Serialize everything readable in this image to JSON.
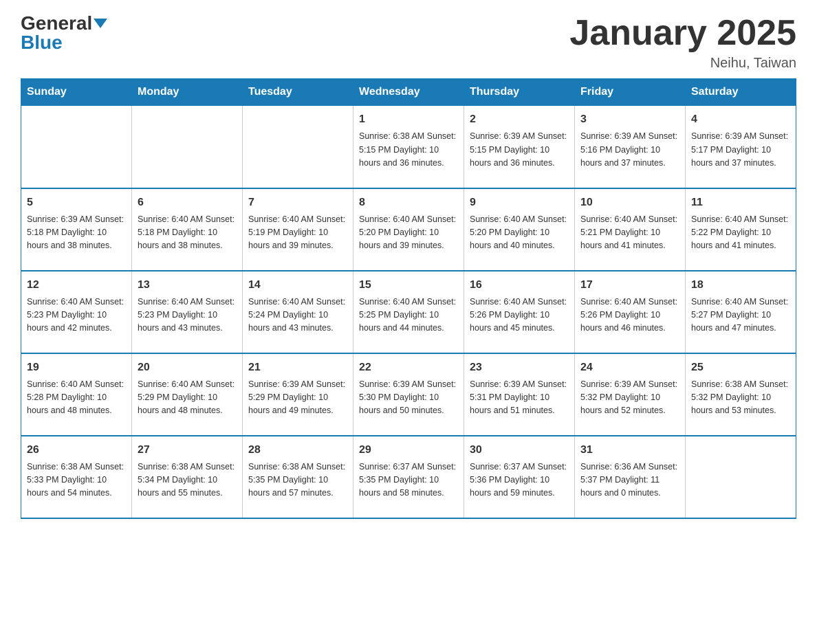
{
  "header": {
    "logo_general": "General",
    "logo_blue": "Blue",
    "title": "January 2025",
    "subtitle": "Neihu, Taiwan"
  },
  "weekdays": [
    "Sunday",
    "Monday",
    "Tuesday",
    "Wednesday",
    "Thursday",
    "Friday",
    "Saturday"
  ],
  "weeks": [
    [
      {
        "day": "",
        "info": ""
      },
      {
        "day": "",
        "info": ""
      },
      {
        "day": "",
        "info": ""
      },
      {
        "day": "1",
        "info": "Sunrise: 6:38 AM\nSunset: 5:15 PM\nDaylight: 10 hours\nand 36 minutes."
      },
      {
        "day": "2",
        "info": "Sunrise: 6:39 AM\nSunset: 5:15 PM\nDaylight: 10 hours\nand 36 minutes."
      },
      {
        "day": "3",
        "info": "Sunrise: 6:39 AM\nSunset: 5:16 PM\nDaylight: 10 hours\nand 37 minutes."
      },
      {
        "day": "4",
        "info": "Sunrise: 6:39 AM\nSunset: 5:17 PM\nDaylight: 10 hours\nand 37 minutes."
      }
    ],
    [
      {
        "day": "5",
        "info": "Sunrise: 6:39 AM\nSunset: 5:18 PM\nDaylight: 10 hours\nand 38 minutes."
      },
      {
        "day": "6",
        "info": "Sunrise: 6:40 AM\nSunset: 5:18 PM\nDaylight: 10 hours\nand 38 minutes."
      },
      {
        "day": "7",
        "info": "Sunrise: 6:40 AM\nSunset: 5:19 PM\nDaylight: 10 hours\nand 39 minutes."
      },
      {
        "day": "8",
        "info": "Sunrise: 6:40 AM\nSunset: 5:20 PM\nDaylight: 10 hours\nand 39 minutes."
      },
      {
        "day": "9",
        "info": "Sunrise: 6:40 AM\nSunset: 5:20 PM\nDaylight: 10 hours\nand 40 minutes."
      },
      {
        "day": "10",
        "info": "Sunrise: 6:40 AM\nSunset: 5:21 PM\nDaylight: 10 hours\nand 41 minutes."
      },
      {
        "day": "11",
        "info": "Sunrise: 6:40 AM\nSunset: 5:22 PM\nDaylight: 10 hours\nand 41 minutes."
      }
    ],
    [
      {
        "day": "12",
        "info": "Sunrise: 6:40 AM\nSunset: 5:23 PM\nDaylight: 10 hours\nand 42 minutes."
      },
      {
        "day": "13",
        "info": "Sunrise: 6:40 AM\nSunset: 5:23 PM\nDaylight: 10 hours\nand 43 minutes."
      },
      {
        "day": "14",
        "info": "Sunrise: 6:40 AM\nSunset: 5:24 PM\nDaylight: 10 hours\nand 43 minutes."
      },
      {
        "day": "15",
        "info": "Sunrise: 6:40 AM\nSunset: 5:25 PM\nDaylight: 10 hours\nand 44 minutes."
      },
      {
        "day": "16",
        "info": "Sunrise: 6:40 AM\nSunset: 5:26 PM\nDaylight: 10 hours\nand 45 minutes."
      },
      {
        "day": "17",
        "info": "Sunrise: 6:40 AM\nSunset: 5:26 PM\nDaylight: 10 hours\nand 46 minutes."
      },
      {
        "day": "18",
        "info": "Sunrise: 6:40 AM\nSunset: 5:27 PM\nDaylight: 10 hours\nand 47 minutes."
      }
    ],
    [
      {
        "day": "19",
        "info": "Sunrise: 6:40 AM\nSunset: 5:28 PM\nDaylight: 10 hours\nand 48 minutes."
      },
      {
        "day": "20",
        "info": "Sunrise: 6:40 AM\nSunset: 5:29 PM\nDaylight: 10 hours\nand 48 minutes."
      },
      {
        "day": "21",
        "info": "Sunrise: 6:39 AM\nSunset: 5:29 PM\nDaylight: 10 hours\nand 49 minutes."
      },
      {
        "day": "22",
        "info": "Sunrise: 6:39 AM\nSunset: 5:30 PM\nDaylight: 10 hours\nand 50 minutes."
      },
      {
        "day": "23",
        "info": "Sunrise: 6:39 AM\nSunset: 5:31 PM\nDaylight: 10 hours\nand 51 minutes."
      },
      {
        "day": "24",
        "info": "Sunrise: 6:39 AM\nSunset: 5:32 PM\nDaylight: 10 hours\nand 52 minutes."
      },
      {
        "day": "25",
        "info": "Sunrise: 6:38 AM\nSunset: 5:32 PM\nDaylight: 10 hours\nand 53 minutes."
      }
    ],
    [
      {
        "day": "26",
        "info": "Sunrise: 6:38 AM\nSunset: 5:33 PM\nDaylight: 10 hours\nand 54 minutes."
      },
      {
        "day": "27",
        "info": "Sunrise: 6:38 AM\nSunset: 5:34 PM\nDaylight: 10 hours\nand 55 minutes."
      },
      {
        "day": "28",
        "info": "Sunrise: 6:38 AM\nSunset: 5:35 PM\nDaylight: 10 hours\nand 57 minutes."
      },
      {
        "day": "29",
        "info": "Sunrise: 6:37 AM\nSunset: 5:35 PM\nDaylight: 10 hours\nand 58 minutes."
      },
      {
        "day": "30",
        "info": "Sunrise: 6:37 AM\nSunset: 5:36 PM\nDaylight: 10 hours\nand 59 minutes."
      },
      {
        "day": "31",
        "info": "Sunrise: 6:36 AM\nSunset: 5:37 PM\nDaylight: 11 hours\nand 0 minutes."
      },
      {
        "day": "",
        "info": ""
      }
    ]
  ]
}
